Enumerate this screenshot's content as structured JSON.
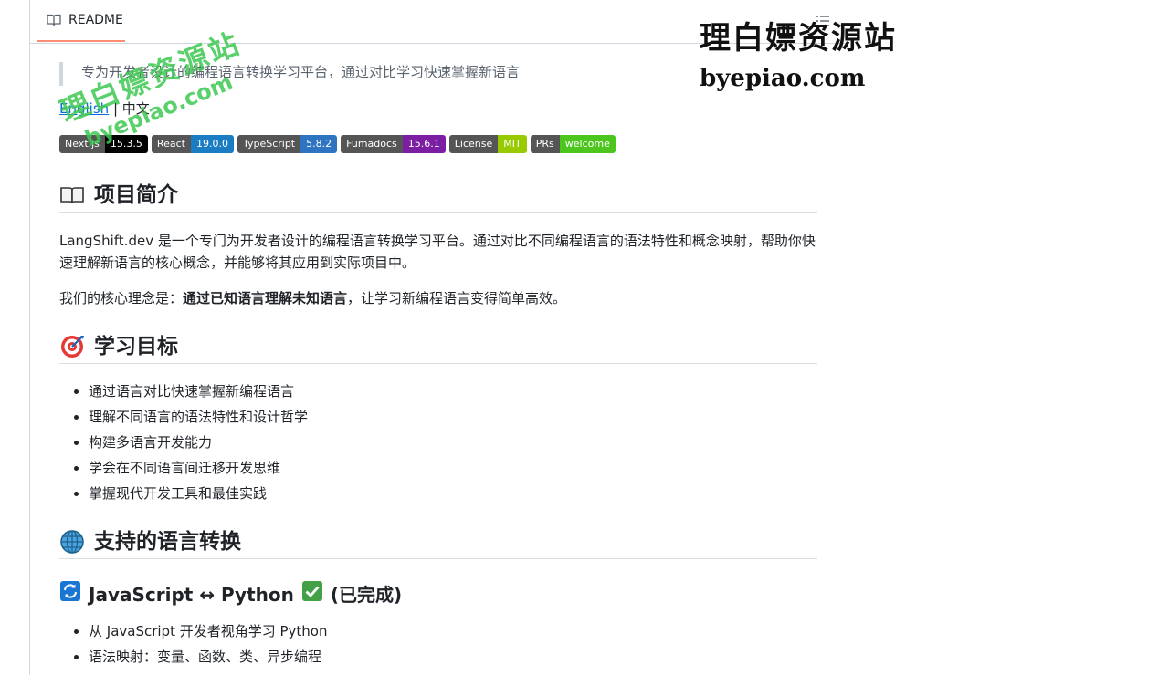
{
  "readme": {
    "tab_label": "README",
    "tagline": "专为开发者设计的编程语言转换学习平台，通过对比学习快速掌握新语言",
    "lang_switch": {
      "english": "English",
      "separator": " | ",
      "chinese": "中文"
    },
    "badges": [
      {
        "label": "Next.js",
        "value": "15.3.5",
        "color": "#000000"
      },
      {
        "label": "React",
        "value": "19.0.0",
        "color": "#1a7dc4"
      },
      {
        "label": "TypeScript",
        "value": "5.8.2",
        "color": "#2f74c0"
      },
      {
        "label": "Fumadocs",
        "value": "15.6.1",
        "color": "#7b1ea2"
      },
      {
        "label": "License",
        "value": "MIT",
        "color": "#97ca00"
      },
      {
        "label": "PRs",
        "value": "welcome",
        "color": "#4cc61e"
      }
    ],
    "sections": {
      "intro": {
        "title": "项目简介",
        "para1": "LangShift.dev 是一个专门为开发者设计的编程语言转换学习平台。通过对比不同编程语言的语法特性和概念映射，帮助你快速理解新语言的核心概念，并能够将其应用到实际项目中。",
        "para2_pre": "我们的核心理念是：",
        "para2_bold": "通过已知语言理解未知语言",
        "para2_post": "，让学习新编程语言变得简单高效。"
      },
      "goals": {
        "title": "学习目标",
        "items": [
          "通过语言对比快速掌握新编程语言",
          "理解不同语言的语法特性和设计哲学",
          "构建多语言开发能力",
          "学会在不同语言间迁移开发思维",
          "掌握现代开发工具和最佳实践"
        ]
      },
      "languages": {
        "title": "支持的语言转换",
        "sub": {
          "title": "JavaScript ↔ Python",
          "status": "(已完成)",
          "items": [
            "从 JavaScript 开发者视角学习 Python",
            "语法映射：变量、函数、类、异步编程"
          ]
        }
      }
    }
  },
  "watermark": {
    "text_cn": "理白嫖资源站",
    "text_url": "byepiao.com"
  }
}
